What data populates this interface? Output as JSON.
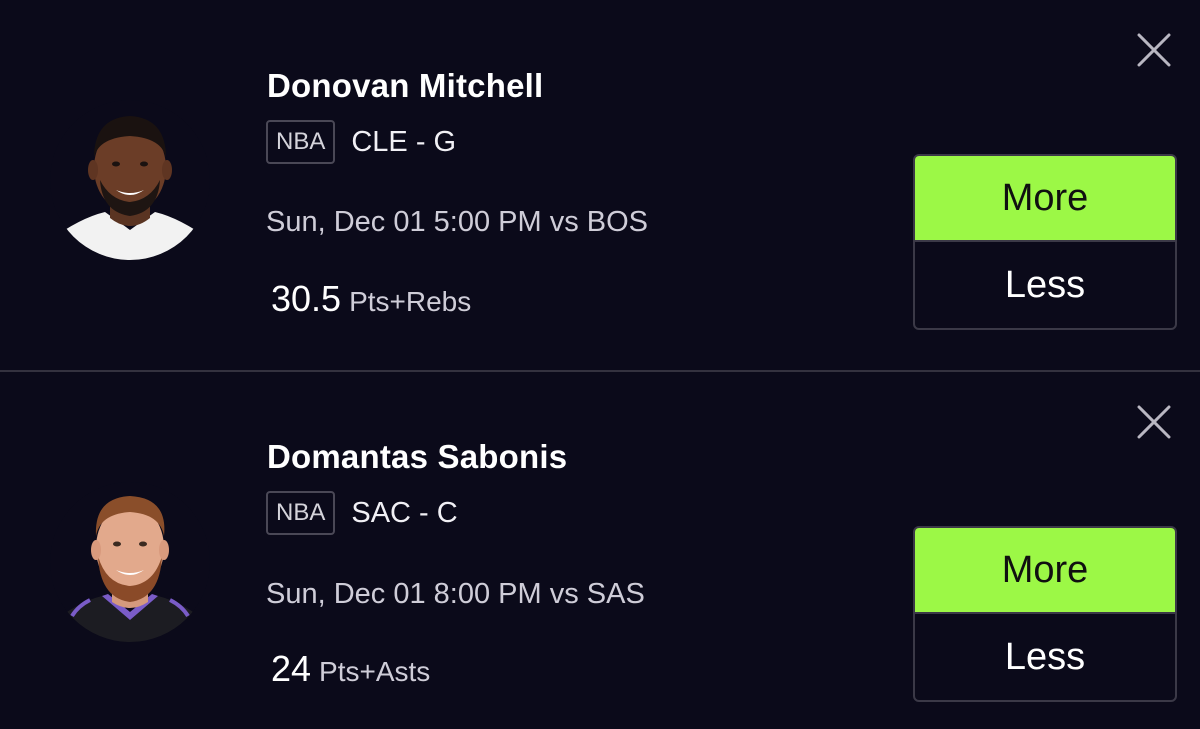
{
  "colors": {
    "background": "#0b0a1a",
    "accent_more": "#9cf846",
    "divider": "#34323f"
  },
  "picks": [
    {
      "player_name": "Donovan Mitchell",
      "league": "NBA",
      "team_position": "CLE - G",
      "game_info": "Sun, Dec 01 5:00 PM vs BOS",
      "line_value": "30.5",
      "line_stat": "Pts+Rebs",
      "more_label": "More",
      "less_label": "Less",
      "close_icon": "close-icon",
      "avatar_icon": "player-headshot"
    },
    {
      "player_name": "Domantas Sabonis",
      "league": "NBA",
      "team_position": "SAC - C",
      "game_info": "Sun, Dec 01 8:00 PM vs SAS",
      "line_value": "24",
      "line_stat": "Pts+Asts",
      "more_label": "More",
      "less_label": "Less",
      "close_icon": "close-icon",
      "avatar_icon": "player-headshot"
    }
  ]
}
